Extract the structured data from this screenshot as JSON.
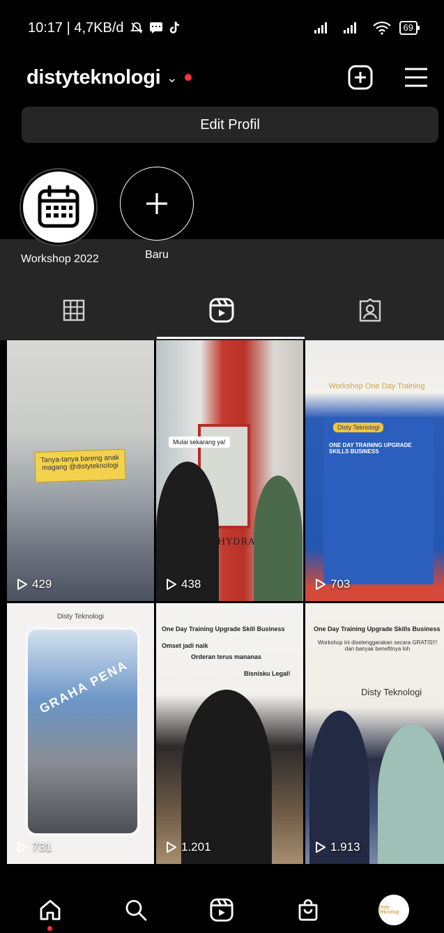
{
  "status_bar": {
    "time_info": "10:17 | 4,7KB/d",
    "battery": "69"
  },
  "header": {
    "username": "distyteknologi",
    "chevron": "⌄"
  },
  "profile": {
    "edit_button": "Edit Profil"
  },
  "highlights": [
    {
      "label": "Workshop 2022",
      "icon": "calendar-icon"
    },
    {
      "label": "Baru",
      "icon": "plus-icon"
    }
  ],
  "tabs": [
    {
      "name": "grid",
      "icon": "grid-icon"
    },
    {
      "name": "reels",
      "icon": "reels-icon",
      "active": true
    },
    {
      "name": "tagged",
      "icon": "tagged-icon"
    }
  ],
  "posts": [
    {
      "views": "429"
    },
    {
      "views": "438"
    },
    {
      "views": "703"
    },
    {
      "views": "731"
    },
    {
      "views": "1.201"
    },
    {
      "views": "1.913"
    }
  ],
  "post_texts": {
    "p1_sticker": "Tanya-tanya bareng anak magang @distyteknologi",
    "p2_bubble": "Mulai sekarang ya!",
    "p2_sign": "HYDRANT",
    "p3_overlay": "Workshop One Day Training",
    "p3_poster_title": "ONE DAY TRAINING UPGRADE SKILLS BUSINESS",
    "p3_brand": "Disty Teknologi",
    "p4_brand": "Disty Teknologi",
    "p4_building": "GRAHA PENA",
    "p5_line1": "One Day Training Upgrade Skill Business",
    "p5_line2": "Omset jadi naik",
    "p5_line3": "Orderan terus mananas",
    "p5_line4": "Bisnisku Legal!",
    "p6_line1": "One Day Training Upgrade Skills Business",
    "p6_line2": "Workshop ini diselenggarakan secara GRATIS!!! dan banyak benefitnya loh",
    "p6_brand": "Disty Teknologi"
  },
  "bottom_nav": [
    {
      "name": "home",
      "icon": "home-icon"
    },
    {
      "name": "search",
      "icon": "search-icon"
    },
    {
      "name": "reels",
      "icon": "reels-icon"
    },
    {
      "name": "shop",
      "icon": "shop-icon"
    },
    {
      "name": "profile",
      "avatar_text": "Disty Teknologi"
    }
  ],
  "colors": {
    "background": "#000000",
    "surface": "#262626",
    "notification": "#ff3040",
    "text": "#ffffff"
  }
}
